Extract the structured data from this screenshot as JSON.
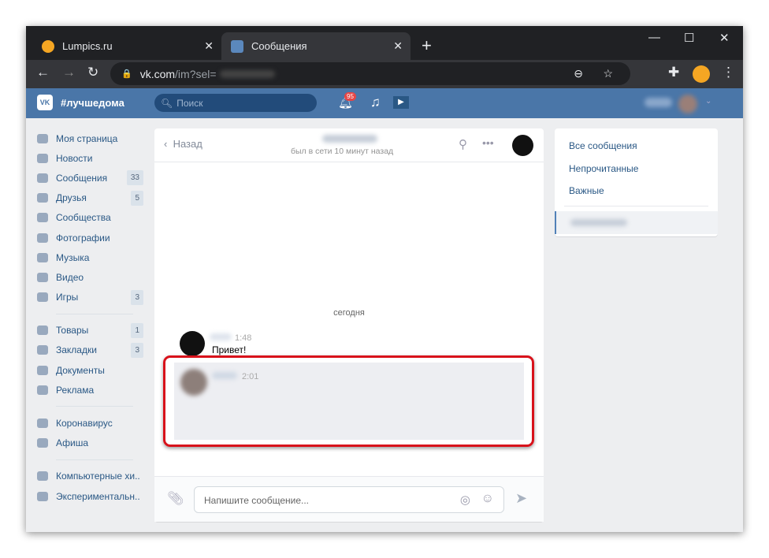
{
  "browser": {
    "tabs": [
      {
        "title": "Lumpics.ru",
        "active": false
      },
      {
        "title": "Сообщения",
        "active": true
      }
    ],
    "new_tab": "+",
    "url_host": "vk.com",
    "url_path": "/im?sel="
  },
  "vk": {
    "hashtag": "#лучшедома",
    "search_placeholder": "Поиск",
    "notifications": "95",
    "accent": "#4a76a8"
  },
  "sidebar": {
    "items": [
      {
        "label": "Моя страница",
        "icon": "home-icon"
      },
      {
        "label": "Новости",
        "icon": "news-icon"
      },
      {
        "label": "Сообщения",
        "icon": "messages-icon",
        "badge": "33"
      },
      {
        "label": "Друзья",
        "icon": "friends-icon",
        "badge": "5"
      },
      {
        "label": "Сообщества",
        "icon": "groups-icon"
      },
      {
        "label": "Фотографии",
        "icon": "camera-icon"
      },
      {
        "label": "Музыка",
        "icon": "music-icon"
      },
      {
        "label": "Видео",
        "icon": "video-icon"
      },
      {
        "label": "Игры",
        "icon": "games-icon",
        "badge": "3"
      },
      {
        "label": "Товары",
        "icon": "bag-icon",
        "badge": "1"
      },
      {
        "label": "Закладки",
        "icon": "star-icon",
        "badge": "3"
      },
      {
        "label": "Документы",
        "icon": "document-icon"
      },
      {
        "label": "Реклама",
        "icon": "megaphone-icon"
      },
      {
        "label": "Коронавирус",
        "icon": "virus-icon"
      },
      {
        "label": "Афиша",
        "icon": "play-icon"
      },
      {
        "label": "Компьютерные хи..",
        "icon": "groups-icon"
      },
      {
        "label": "Экспериментальн..",
        "icon": "groups-icon"
      }
    ]
  },
  "chat": {
    "back": "Назад",
    "status": "был в сети 10 минут назад",
    "date_divider": "сегодня",
    "messages": [
      {
        "time": "1:48",
        "text": "Привет!"
      },
      {
        "time": "2:01",
        "text": ""
      }
    ],
    "input_placeholder": "Напишите сообщение..."
  },
  "right": {
    "items": [
      "Все сообщения",
      "Непрочитанные",
      "Важные"
    ]
  }
}
